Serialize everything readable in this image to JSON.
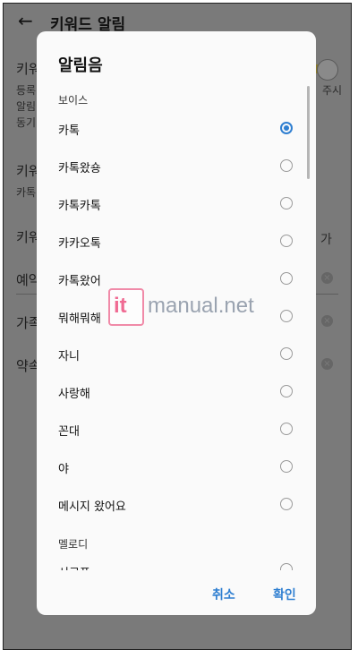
{
  "background": {
    "title": "키워드 알림",
    "rows": {
      "r1": "키워",
      "r1_sub1": "등록",
      "r1_sub2": "알림",
      "r1_sub3": "동기",
      "r1_right": "주시",
      "r2": "키워",
      "r2_sub": "카톡",
      "r3": "키워",
      "r3_right": "가",
      "r4": "예약",
      "r5": "가족",
      "r6": "약속"
    }
  },
  "dialog": {
    "title": "알림음",
    "sections": {
      "voice": "보이스",
      "melody": "멜로디"
    },
    "options": [
      {
        "label": "카톡",
        "selected": true
      },
      {
        "label": "카톡왔숑",
        "selected": false
      },
      {
        "label": "카톡카톡",
        "selected": false
      },
      {
        "label": "카카오톡",
        "selected": false
      },
      {
        "label": "카톡왔어",
        "selected": false
      },
      {
        "label": "뭐해뭐해",
        "selected": false
      },
      {
        "label": "자니",
        "selected": false
      },
      {
        "label": "사랑해",
        "selected": false
      },
      {
        "label": "꼰대",
        "selected": false
      },
      {
        "label": "야",
        "selected": false
      },
      {
        "label": "메시지 왔어요",
        "selected": false
      }
    ],
    "partial_option": "시크프",
    "buttons": {
      "cancel": "취소",
      "confirm": "확인"
    }
  },
  "watermark": {
    "prefix": "it",
    "text": "manual.net"
  },
  "colors": {
    "accent": "#2f7fd1",
    "dim_overlay": "#7a7a7a",
    "dialog_bg": "#fafafa"
  }
}
